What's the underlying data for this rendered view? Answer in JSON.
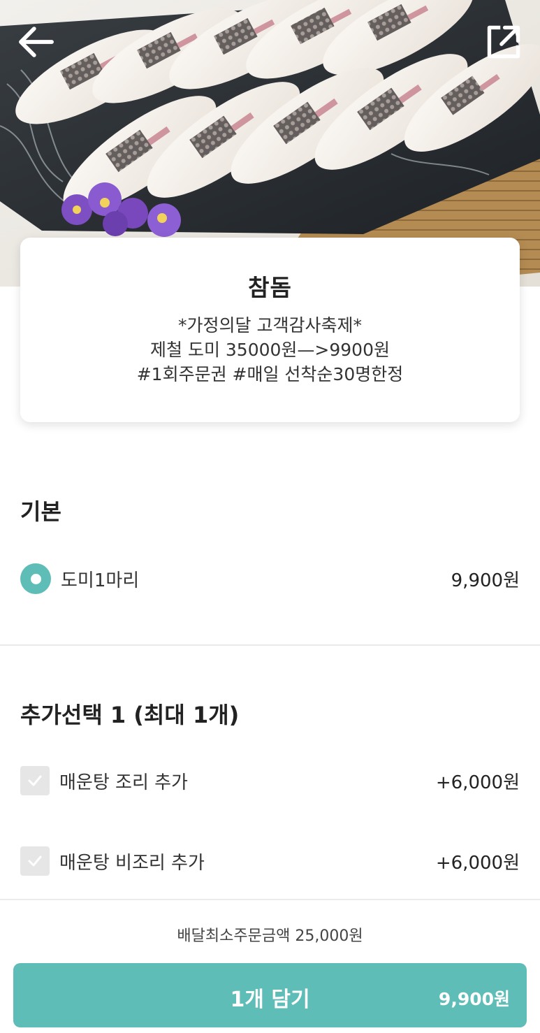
{
  "header": {
    "back_icon": "arrow-left-icon",
    "share_icon": "share-external-icon"
  },
  "product": {
    "name": "참돔",
    "description_lines": [
      "*가정의달 고객감사축제*",
      "제철 도미 35000원—>9900원",
      "#1회주문권 #매일 선착순30명한정"
    ]
  },
  "sections": {
    "basic": {
      "title": "기본",
      "options": [
        {
          "label": "도미1마리",
          "price": "9,900원",
          "selected": true
        }
      ]
    },
    "extra": {
      "title": "추가선택 1 (최대 1개)",
      "options": [
        {
          "label": "매운탕 조리 추가",
          "price": "+6,000원",
          "checked": false
        },
        {
          "label": "매운탕 비조리 추가",
          "price": "+6,000원",
          "checked": false
        }
      ]
    }
  },
  "bottom": {
    "min_order": "배달최소주문금액 25,000원",
    "cart_button_label": "1개 담기",
    "cart_button_price": "9,900원"
  },
  "colors": {
    "accent": "#5fbdb7",
    "checkbox_unchecked": "#e6e6e6",
    "divider": "#e9e9e9"
  }
}
